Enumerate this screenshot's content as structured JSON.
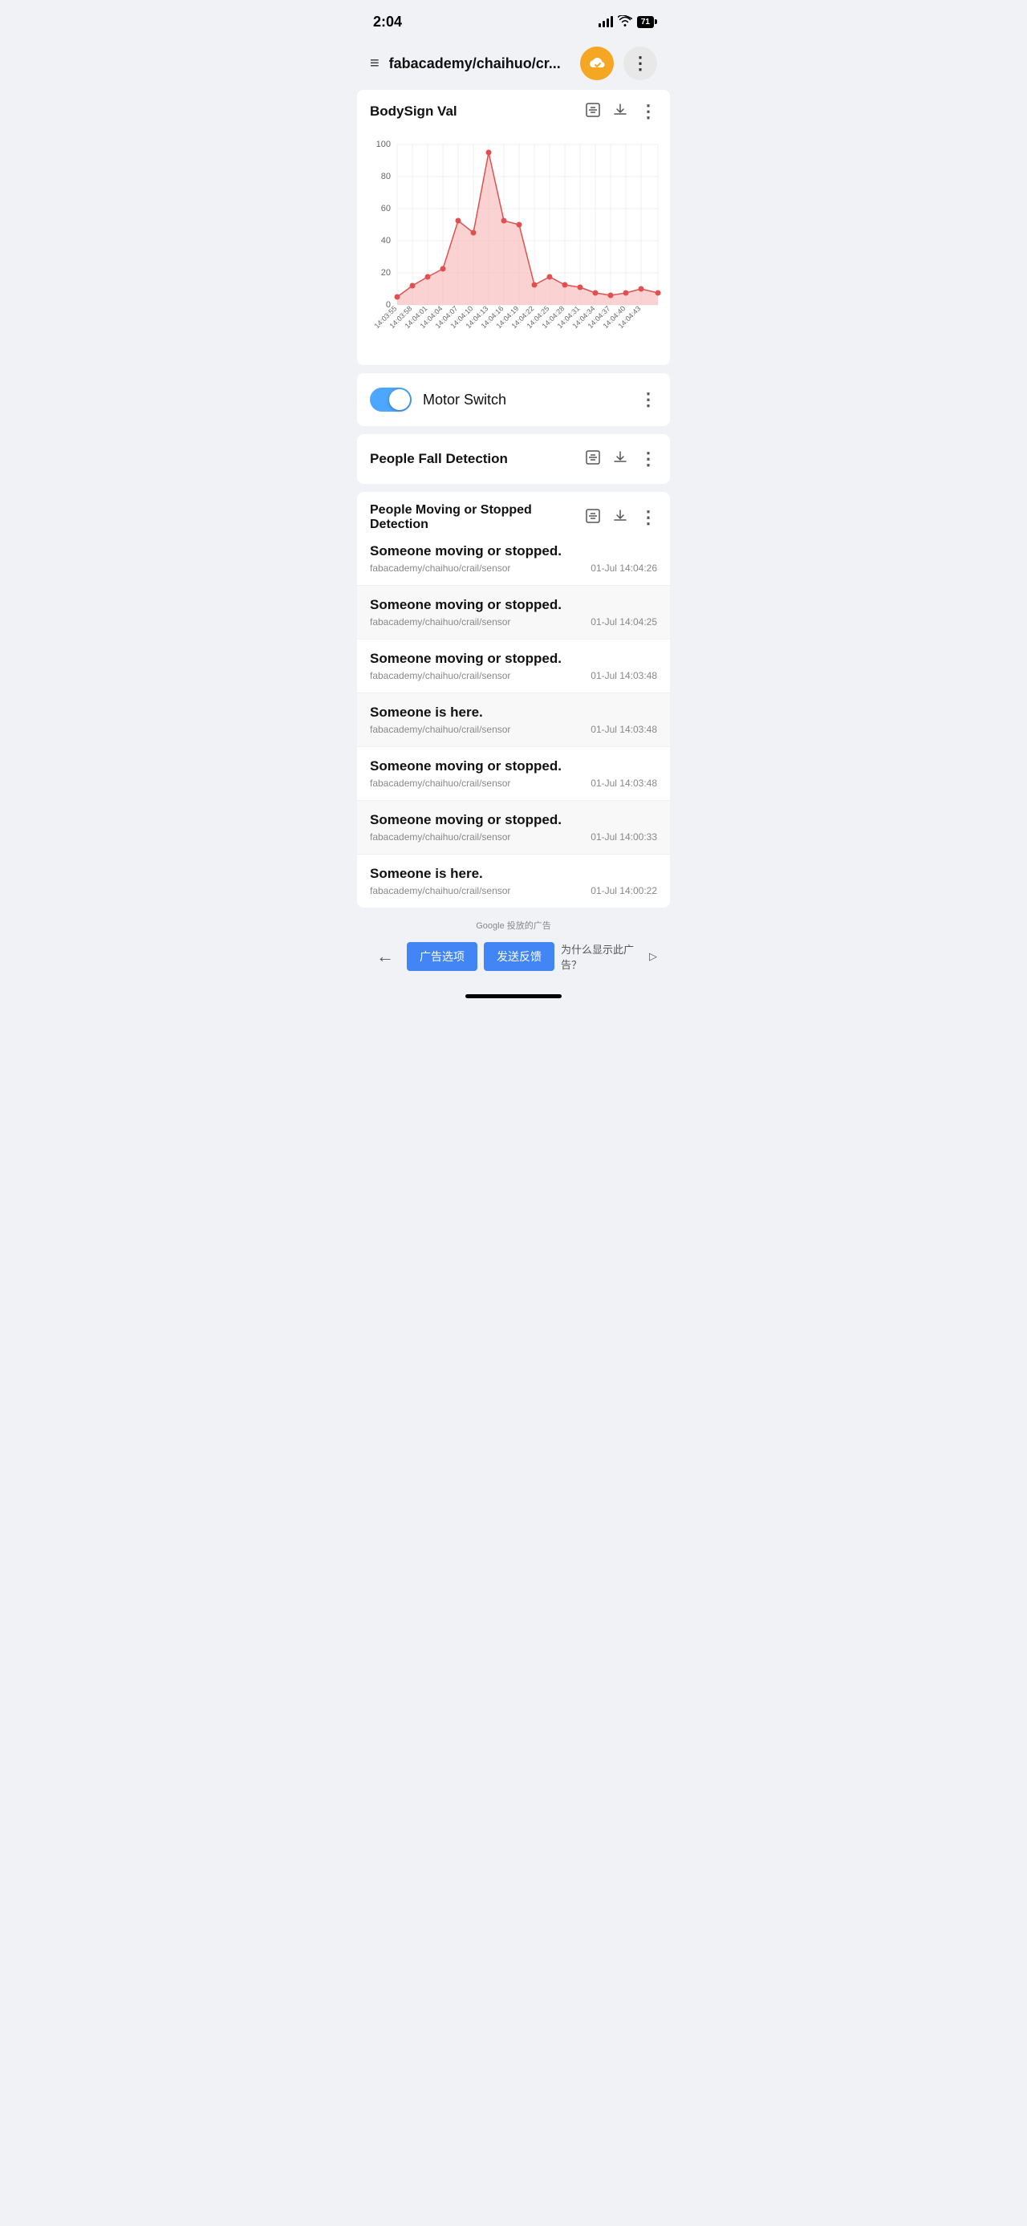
{
  "status": {
    "time": "2:04",
    "battery": "71"
  },
  "nav": {
    "title": "fabacademy/chaihuo/cr...",
    "cloud_icon": "☁",
    "more_icon": "⋮",
    "menu_icon": "≡"
  },
  "chart": {
    "title": "BodySign Val",
    "y_labels": [
      "100",
      "80",
      "60",
      "40",
      "20",
      "0"
    ],
    "x_labels": [
      "14:03:55",
      "14:03:58",
      "14:04:01",
      "14:04:04",
      "14:04:07",
      "14:04:10",
      "14:04:13",
      "14:04:16",
      "14:04:19",
      "14:04:22",
      "14:04:25",
      "14:04:28",
      "14:04:31",
      "14:04:34",
      "14:04:37",
      "14:04:40",
      "14:04:43"
    ],
    "filter_icon": "⊡",
    "download_icon": "⬇",
    "more_icon": "⋮"
  },
  "motor_switch": {
    "label": "Motor Switch",
    "more_icon": "⋮",
    "enabled": true
  },
  "people_fall": {
    "title": "People Fall Detection",
    "filter_icon": "⊡",
    "download_icon": "⬇",
    "more_icon": "⋮"
  },
  "people_moving": {
    "title": "People Moving or Stopped Detection",
    "filter_icon": "⊡",
    "download_icon": "⬇",
    "more_icon": "⋮",
    "items": [
      {
        "title": "Someone moving or stopped.",
        "source": "fabacademy/chaihuo/crail/sensor",
        "time": "01-Jul 14:04:26",
        "even": false
      },
      {
        "title": "Someone moving or stopped.",
        "source": "fabacademy/chaihuo/crail/sensor",
        "time": "01-Jul 14:04:25",
        "even": true
      },
      {
        "title": "Someone moving or stopped.",
        "source": "fabacademy/chaihuo/crail/sensor",
        "time": "01-Jul 14:03:48",
        "even": false
      },
      {
        "title": "Someone is here.",
        "source": "fabacademy/chaihuo/crail/sensor",
        "time": "01-Jul 14:03:48",
        "even": true
      },
      {
        "title": "Someone moving or stopped.",
        "source": "fabacademy/chaihuo/crail/sensor",
        "time": "01-Jul 14:03:48",
        "even": false
      },
      {
        "title": "Someone moving or stopped.",
        "source": "fabacademy/chaihuo/crail/sensor",
        "time": "01-Jul 14:00:33",
        "even": true
      },
      {
        "title": "Someone is here.",
        "source": "fabacademy/chaihuo/crail/sensor",
        "time": "01-Jul 14:00:22",
        "even": false
      }
    ]
  },
  "ad": {
    "label": "Google 投放的广告",
    "btn1": "广告选项",
    "btn2": "发送反馈",
    "why": "为什么显示此广告？"
  }
}
